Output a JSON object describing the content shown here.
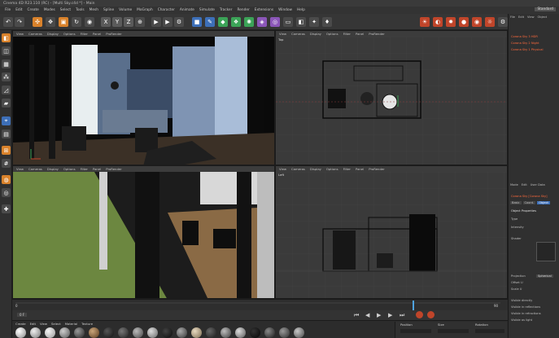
{
  "window": {
    "title": "Cinema 4D R23.110 (RC) - [Multi Sky.c4d *] - Main"
  },
  "menu": [
    "File",
    "Edit",
    "Create",
    "Modes",
    "Select",
    "Tools",
    "Mesh",
    "Spline",
    "Volume",
    "MoGraph",
    "Character",
    "Animate",
    "Simulate",
    "Tracker",
    "Render",
    "Extensions",
    "Window",
    "Help"
  ],
  "layout": "Standard",
  "viewports": {
    "perspective": {
      "label": "Perspective",
      "menu": [
        "View",
        "Cameras",
        "Display",
        "Options",
        "Filter",
        "Panel",
        "ProRender"
      ]
    },
    "top": {
      "label": "Top",
      "menu": [
        "View",
        "Cameras",
        "Display",
        "Options",
        "Filter",
        "Panel",
        "ProRender"
      ]
    },
    "perspective2": {
      "label": "Perspective",
      "menu": [
        "View",
        "Cameras",
        "Display",
        "Options",
        "Filter",
        "Panel",
        "ProRender"
      ]
    },
    "left": {
      "label": "Left",
      "menu": [
        "View",
        "Cameras",
        "Display",
        "Options",
        "Filter",
        "Panel",
        "ProRender"
      ]
    }
  },
  "objects": {
    "menu": [
      "File",
      "Edit",
      "View",
      "Object"
    ],
    "items": [
      "Corona Sky 3 HDR",
      "Corona Sky 2 Night",
      "Corona Sky 1 Physical"
    ]
  },
  "attributes": {
    "menu": [
      "Mode",
      "Edit",
      "User Data"
    ],
    "object": "Corona Sky [Corona Sky]",
    "tabs": [
      "Basic",
      "Coord.",
      "Object"
    ],
    "section": "Object Properties",
    "rows": [
      "Type",
      "Intensity",
      "Shader",
      "Projection",
      "Offset U",
      "Scale U",
      "Visible directly",
      "Visible in reflections",
      "Visible in refractions",
      "Visible as light"
    ],
    "projection_value": "Spherical"
  },
  "timeline": {
    "start": "0",
    "end": "90",
    "current": "0 F"
  },
  "materials": {
    "menu": [
      "Create",
      "Edit",
      "View",
      "Select",
      "Material",
      "Texture"
    ]
  },
  "coords": {
    "labels": [
      "Position",
      "Size",
      "Rotation"
    ]
  },
  "colors": {
    "accent": "#ff6a3d",
    "bg": "#2b2b2b",
    "panel": "#303030"
  }
}
